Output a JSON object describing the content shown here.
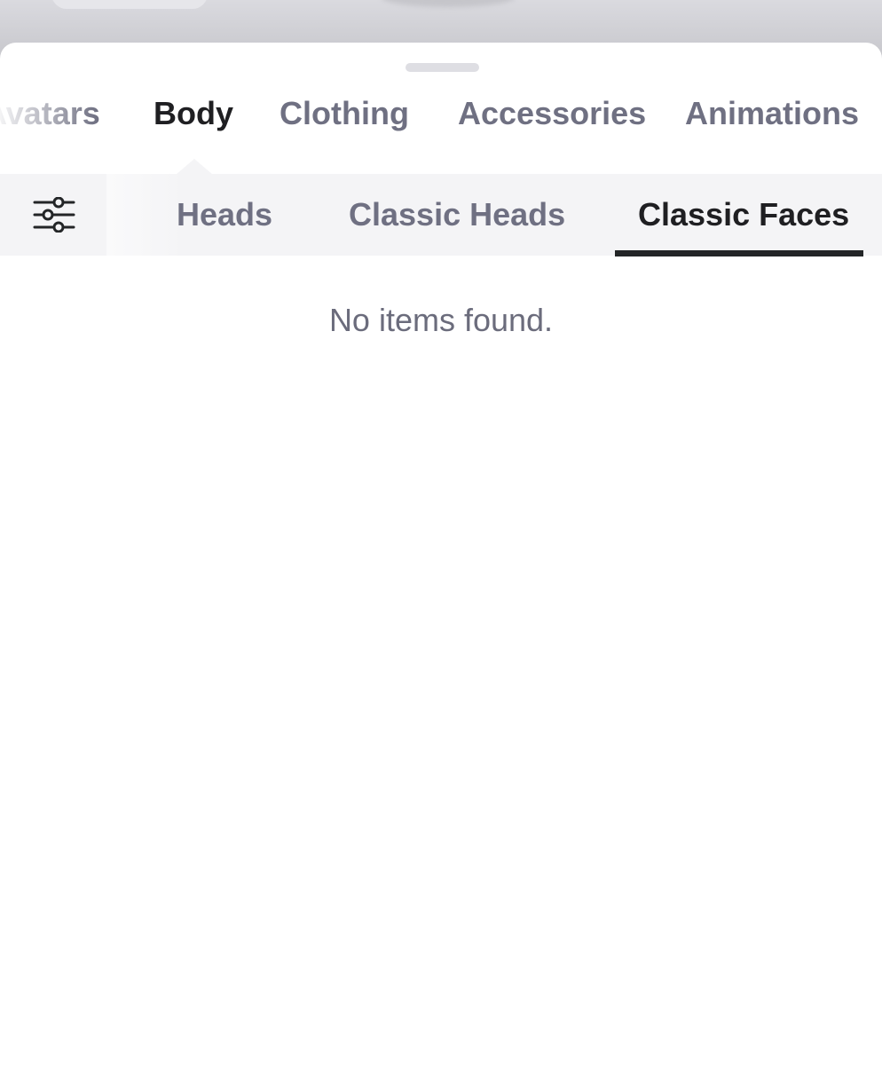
{
  "categories": {
    "tabs": [
      {
        "label": "Avatars"
      },
      {
        "label": "Body"
      },
      {
        "label": "Clothing"
      },
      {
        "label": "Accessories"
      },
      {
        "label": "Animations"
      }
    ],
    "active": "Body"
  },
  "filter": {
    "icon": "sliders-icon"
  },
  "subcategories": {
    "tabs": [
      {
        "label": "Heads"
      },
      {
        "label": "Classic Heads"
      },
      {
        "label": "Classic Faces"
      }
    ],
    "active": "Classic Faces"
  },
  "content": {
    "empty_message": "No items found."
  },
  "colors": {
    "active_text": "#1f1f22",
    "inactive_text": "#6f7082",
    "subbar_bg": "#f4f4f6",
    "underline": "#232527"
  }
}
